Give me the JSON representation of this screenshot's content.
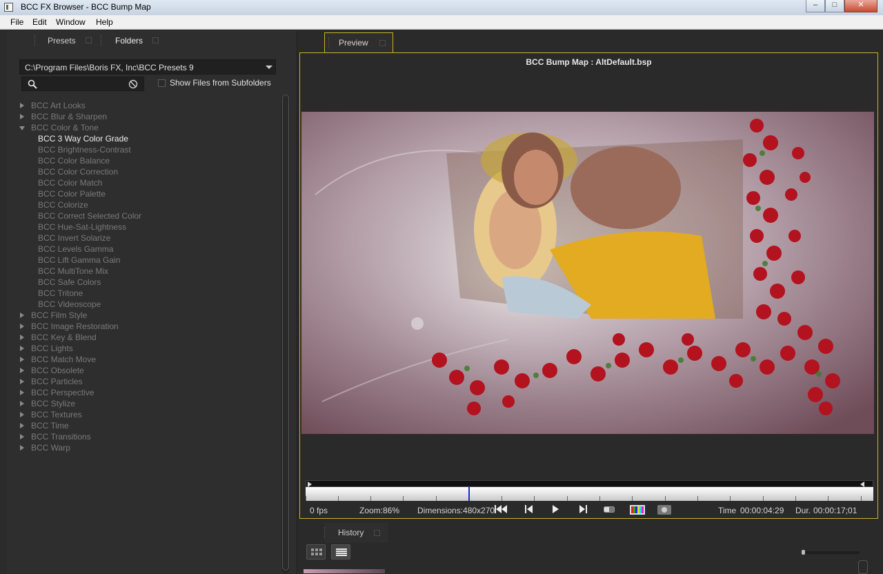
{
  "window": {
    "title": "BCC FX Browser - BCC Bump Map",
    "controls": [
      "–",
      "□",
      "✕"
    ]
  },
  "menu": [
    "File",
    "Edit",
    "Window",
    "Help"
  ],
  "left": {
    "tabs": [
      "Presets",
      "Folders"
    ],
    "path": "C:\\Program Files\\Boris FX, Inc\\BCC Presets 9",
    "search": {
      "placeholder": ""
    },
    "show_subfolders_label": "Show Files from Subfolders",
    "categories_top": [
      "BCC Art Looks",
      "BCC Blur & Sharpen"
    ],
    "open_category": "BCC Color & Tone",
    "children": [
      "BCC 3 Way Color Grade",
      "BCC Brightness-Contrast",
      "BCC Color Balance",
      "BCC Color Correction",
      "BCC Color Match",
      "BCC Color Palette",
      "BCC Colorize",
      "BCC Correct Selected Color",
      "BCC Hue-Sat-Lightness",
      "BCC Invert Solarize",
      "BCC Levels Gamma",
      "BCC Lift Gamma Gain",
      "BCC MultiTone Mix",
      "BCC Safe Colors",
      "BCC Tritone",
      "BCC Videoscope"
    ],
    "selected_child": "BCC 3 Way Color Grade",
    "categories_bottom": [
      "BCC Film Style",
      "BCC Image Restoration",
      "BCC Key & Blend",
      "BCC Lights",
      "BCC Match Move",
      "BCC Obsolete",
      "BCC Particles",
      "BCC Perspective",
      "BCC Stylize",
      "BCC Textures",
      "BCC Time",
      "BCC Transitions",
      "BCC Warp"
    ]
  },
  "preview": {
    "tab": "Preview",
    "title": "BCC Bump Map : AltDefault.bsp",
    "fps": "0 fps",
    "zoom": "Zoom:86%",
    "dimensions": "Dimensions:480x270",
    "time_label": "Time",
    "time_value": "00:00:04:29",
    "dur_label": "Dur.",
    "dur_value": "00:00:17;01",
    "playhead_fraction": 0.287
  },
  "history": {
    "tab": "History"
  },
  "colors": {
    "accent_border": "#c8b428",
    "playhead": "#1a2ad0"
  }
}
